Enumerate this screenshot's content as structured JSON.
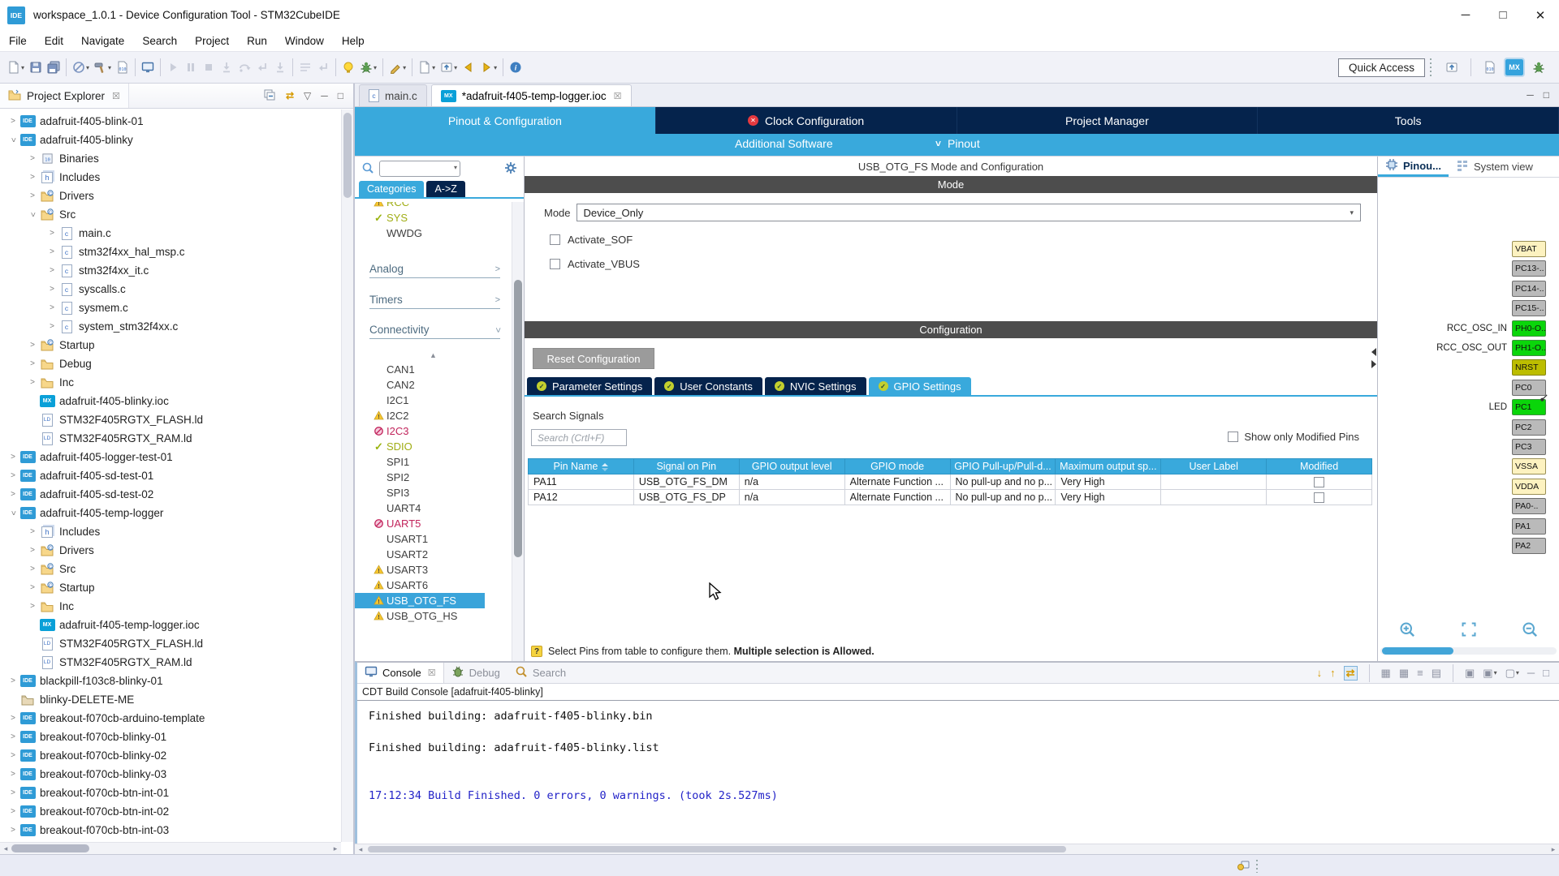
{
  "colors": {
    "accent": "#39a9dc",
    "navy": "#05234c",
    "section_gray": "#4d4d4d",
    "pin_green": "#0ad60a",
    "pin_gray": "#bababa",
    "pin_power": "#fdf2c0",
    "pin_nrst": "#bcbd00",
    "console_info_blue": "#2323c8"
  },
  "window": {
    "title": "workspace_1.0.1 - Device Configuration Tool - STM32CubeIDE",
    "controls": [
      "minimize",
      "maximize",
      "close"
    ]
  },
  "menu": {
    "items": [
      "File",
      "Edit",
      "Navigate",
      "Search",
      "Project",
      "Run",
      "Window",
      "Help"
    ]
  },
  "toolbar": {
    "icons": [
      {
        "kind": "doc",
        "name": "new-wizard-icon",
        "caret": true
      },
      {
        "kind": "floppy",
        "name": "save-icon"
      },
      {
        "kind": "floppy2",
        "name": "save-all-icon"
      },
      {
        "kind": "sep"
      },
      {
        "kind": "circleslash",
        "name": "skip-breakpoints-icon",
        "caret": true
      },
      {
        "kind": "hammer",
        "name": "build-icon",
        "caret": true
      },
      {
        "kind": "bindoc",
        "name": "binary-tools-icon"
      },
      {
        "kind": "sep"
      },
      {
        "kind": "monitor",
        "name": "device-configuration-icon"
      },
      {
        "kind": "sep"
      },
      {
        "kind": "play",
        "name": "resume-icon",
        "muted": true
      },
      {
        "kind": "pause",
        "name": "suspend-icon",
        "muted": true
      },
      {
        "kind": "stop",
        "name": "terminate-icon",
        "muted": true
      },
      {
        "kind": "stepi",
        "name": "disconnect-icon",
        "muted": true
      },
      {
        "kind": "stepo",
        "name": "step-into-icon",
        "muted": true
      },
      {
        "kind": "stepr",
        "name": "step-over-icon",
        "muted": true
      },
      {
        "kind": "stepi",
        "name": "step-return-icon",
        "muted": true
      },
      {
        "kind": "sep"
      },
      {
        "kind": "lines",
        "name": "instruction-stepping-icon",
        "muted": true
      },
      {
        "kind": "stepr",
        "name": "use-step-filters-icon",
        "muted": true
      },
      {
        "kind": "sep"
      },
      {
        "kind": "bulb",
        "name": "external-tools-icon"
      },
      {
        "kind": "spider",
        "name": "debug-icon",
        "caret": true
      },
      {
        "kind": "sep"
      },
      {
        "kind": "pen",
        "name": "run-icon",
        "caret": true
      },
      {
        "kind": "sep"
      },
      {
        "kind": "doc",
        "name": "profile-icon",
        "caret": true
      },
      {
        "kind": "upload",
        "name": "new-launch-config-icon",
        "caret": true
      },
      {
        "kind": "back",
        "name": "back-icon"
      },
      {
        "kind": "fwd",
        "name": "forward-icon",
        "caret": true
      },
      {
        "kind": "sep"
      },
      {
        "kind": "info",
        "name": "information-icon"
      }
    ],
    "quick_access_label": "Quick Access",
    "perspectives": [
      "open-perspective-icon",
      "cpp-perspective-icon",
      "mx-perspective-icon",
      "debug-perspective-icon"
    ]
  },
  "explorer": {
    "title": "Project Explorer",
    "tools": [
      "collapse-all-icon",
      "link-editor-icon",
      "view-menu-icon",
      "minimize-icon",
      "maximize-icon"
    ],
    "items": [
      {
        "label": "adafruit-f405-blink-01",
        "level": 0,
        "chevron": "collapsed",
        "icon": "project"
      },
      {
        "label": "adafruit-f405-blinky",
        "level": 0,
        "chevron": "expanded",
        "icon": "project"
      },
      {
        "label": "Binaries",
        "level": 1,
        "chevron": "collapsed",
        "icon": "binaries"
      },
      {
        "label": "Includes",
        "level": 1,
        "chevron": "collapsed",
        "icon": "includes"
      },
      {
        "label": "Drivers",
        "level": 1,
        "chevron": "collapsed",
        "icon": "folder-c"
      },
      {
        "label": "Src",
        "level": 1,
        "chevron": "expanded",
        "icon": "folder-c"
      },
      {
        "label": "main.c",
        "level": 2,
        "chevron": "collapsed",
        "icon": "c-file"
      },
      {
        "label": "stm32f4xx_hal_msp.c",
        "level": 2,
        "chevron": "collapsed",
        "icon": "c-file"
      },
      {
        "label": "stm32f4xx_it.c",
        "level": 2,
        "chevron": "collapsed",
        "icon": "c-file"
      },
      {
        "label": "syscalls.c",
        "level": 2,
        "chevron": "collapsed",
        "icon": "c-file"
      },
      {
        "label": "sysmem.c",
        "level": 2,
        "chevron": "collapsed",
        "icon": "c-file"
      },
      {
        "label": "system_stm32f4xx.c",
        "level": 2,
        "chevron": "collapsed",
        "icon": "c-file"
      },
      {
        "label": "Startup",
        "level": 1,
        "chevron": "collapsed",
        "icon": "folder-c"
      },
      {
        "label": "Debug",
        "level": 1,
        "chevron": "collapsed",
        "icon": "folder"
      },
      {
        "label": "Inc",
        "level": 1,
        "chevron": "collapsed",
        "icon": "folder"
      },
      {
        "label": "adafruit-f405-blinky.ioc",
        "level": 1,
        "chevron": "none",
        "icon": "mx"
      },
      {
        "label": "STM32F405RGTX_FLASH.ld",
        "level": 1,
        "chevron": "none",
        "icon": "ld"
      },
      {
        "label": "STM32F405RGTX_RAM.ld",
        "level": 1,
        "chevron": "none",
        "icon": "ld"
      },
      {
        "label": "adafruit-f405-logger-test-01",
        "level": 0,
        "chevron": "collapsed",
        "icon": "project"
      },
      {
        "label": "adafruit-f405-sd-test-01",
        "level": 0,
        "chevron": "collapsed",
        "icon": "project"
      },
      {
        "label": "adafruit-f405-sd-test-02",
        "level": 0,
        "chevron": "collapsed",
        "icon": "project"
      },
      {
        "label": "adafruit-f405-temp-logger",
        "level": 0,
        "chevron": "expanded",
        "icon": "project"
      },
      {
        "label": "Includes",
        "level": 1,
        "chevron": "collapsed",
        "icon": "includes"
      },
      {
        "label": "Drivers",
        "level": 1,
        "chevron": "collapsed",
        "icon": "folder-c"
      },
      {
        "label": "Src",
        "level": 1,
        "chevron": "collapsed",
        "icon": "folder-c"
      },
      {
        "label": "Startup",
        "level": 1,
        "chevron": "collapsed",
        "icon": "folder-c"
      },
      {
        "label": "Inc",
        "level": 1,
        "chevron": "collapsed",
        "icon": "folder"
      },
      {
        "label": "adafruit-f405-temp-logger.ioc",
        "level": 1,
        "chevron": "none",
        "icon": "mx"
      },
      {
        "label": "STM32F405RGTX_FLASH.ld",
        "level": 1,
        "chevron": "none",
        "icon": "ld"
      },
      {
        "label": "STM32F405RGTX_RAM.ld",
        "level": 1,
        "chevron": "none",
        "icon": "ld"
      },
      {
        "label": "blackpill-f103c8-blinky-01",
        "level": 0,
        "chevron": "collapsed",
        "icon": "project"
      },
      {
        "label": "blinky-DELETE-ME",
        "level": 0,
        "chevron": "none",
        "icon": "folder-plain"
      },
      {
        "label": "breakout-f070cb-arduino-template",
        "level": 0,
        "chevron": "collapsed",
        "icon": "project"
      },
      {
        "label": "breakout-f070cb-blinky-01",
        "level": 0,
        "chevron": "collapsed",
        "icon": "project"
      },
      {
        "label": "breakout-f070cb-blinky-02",
        "level": 0,
        "chevron": "collapsed",
        "icon": "project"
      },
      {
        "label": "breakout-f070cb-blinky-03",
        "level": 0,
        "chevron": "collapsed",
        "icon": "project"
      },
      {
        "label": "breakout-f070cb-btn-int-01",
        "level": 0,
        "chevron": "collapsed",
        "icon": "project"
      },
      {
        "label": "breakout-f070cb-btn-int-02",
        "level": 0,
        "chevron": "collapsed",
        "icon": "project"
      },
      {
        "label": "breakout-f070cb-btn-int-03",
        "level": 0,
        "chevron": "collapsed",
        "icon": "project"
      }
    ]
  },
  "editor": {
    "tabs": [
      {
        "label": "main.c",
        "icon": "c-file",
        "active": false,
        "closable": false
      },
      {
        "label": "*adafruit-f405-temp-logger.ioc",
        "icon": "mx",
        "active": true,
        "closable": true
      }
    ]
  },
  "ioc": {
    "config_tabs": [
      {
        "label": "Pinout & Configuration",
        "active": true,
        "error": false
      },
      {
        "label": "Clock Configuration",
        "active": false,
        "error": true
      },
      {
        "label": "Project Manager",
        "active": false,
        "error": false
      },
      {
        "label": "Tools",
        "active": false,
        "error": false
      }
    ],
    "software_bar": {
      "additional": "Additional Software",
      "pinout": "Pinout"
    },
    "categories": {
      "tabs": [
        {
          "label": "Categories",
          "active": true
        },
        {
          "label": "A->Z",
          "active": false
        }
      ],
      "top_items": [
        {
          "label": "RCC",
          "status": "warning",
          "partial": true,
          "olive": true
        },
        {
          "label": "SYS",
          "status": "ok",
          "olive": true
        },
        {
          "label": "WWDG",
          "status": "none",
          "olive": false
        }
      ],
      "sections": [
        {
          "label": "Analog",
          "state": "collapsed"
        },
        {
          "label": "Timers",
          "state": "collapsed"
        },
        {
          "label": "Connectivity",
          "state": "expanded"
        }
      ],
      "connectivity": [
        {
          "label": "CAN1",
          "status": "none"
        },
        {
          "label": "CAN2",
          "status": "none"
        },
        {
          "label": "I2C1",
          "status": "none"
        },
        {
          "label": "I2C2",
          "status": "warning"
        },
        {
          "label": "I2C3",
          "status": "blocked"
        },
        {
          "label": "SDIO",
          "status": "ok",
          "olive": true
        },
        {
          "label": "SPI1",
          "status": "none"
        },
        {
          "label": "SPI2",
          "status": "none"
        },
        {
          "label": "SPI3",
          "status": "none"
        },
        {
          "label": "UART4",
          "status": "none"
        },
        {
          "label": "UART5",
          "status": "blocked"
        },
        {
          "label": "USART1",
          "status": "none"
        },
        {
          "label": "USART2",
          "status": "none"
        },
        {
          "label": "USART3",
          "status": "warning"
        },
        {
          "label": "USART6",
          "status": "warning"
        },
        {
          "label": "USB_OTG_FS",
          "status": "warning",
          "selected": true
        },
        {
          "label": "USB_OTG_HS",
          "status": "warning"
        }
      ]
    },
    "mode": {
      "panel_title": "USB_OTG_FS Mode and Configuration",
      "section_label": "Mode",
      "mode_label": "Mode",
      "mode_value": "Device_Only",
      "checkboxes": [
        {
          "label": "Activate_SOF",
          "checked": false
        },
        {
          "label": "Activate_VBUS",
          "checked": false
        }
      ]
    },
    "configuration": {
      "section_label": "Configuration",
      "reset_button": "Reset Configuration",
      "tabs": [
        {
          "label": "Parameter Settings",
          "active": false
        },
        {
          "label": "User Constants",
          "active": false
        },
        {
          "label": "NVIC Settings",
          "active": false
        },
        {
          "label": "GPIO Settings",
          "active": true
        }
      ],
      "search_label": "Search Signals",
      "search_placeholder": "Search (Crtl+F)",
      "show_modified_label": "Show only Modified Pins",
      "show_modified_checked": false
    },
    "gpio_table": {
      "columns": [
        "Pin Name",
        "Signal on Pin",
        "GPIO output level",
        "GPIO mode",
        "GPIO Pull-up/Pull-d...",
        "Maximum output sp...",
        "User Label",
        "Modified"
      ],
      "sorted_column": "Pin Name",
      "rows": [
        {
          "pin": "PA11",
          "signal": "USB_OTG_FS_DM",
          "level": "n/a",
          "mode": "Alternate Function ...",
          "pull": "No pull-up and no p...",
          "speed": "Very High",
          "user_label": "",
          "modified": false
        },
        {
          "pin": "PA12",
          "signal": "USB_OTG_FS_DP",
          "level": "n/a",
          "mode": "Alternate Function ...",
          "pull": "No pull-up and no p...",
          "speed": "Very High",
          "user_label": "",
          "modified": false
        }
      ]
    },
    "help": {
      "text": "Select Pins from table to configure them. ",
      "bold": "Multiple selection is Allowed."
    },
    "pinout": {
      "tabs": [
        {
          "label": "Pinou...",
          "active": true,
          "icon": "chip-icon"
        },
        {
          "label": "System view",
          "active": false,
          "icon": "grid-icon"
        }
      ],
      "pins": [
        {
          "label": "VBAT",
          "color": "power"
        },
        {
          "label": "PC13-..",
          "color": "default"
        },
        {
          "label": "PC14-..",
          "color": "default"
        },
        {
          "label": "PC15-..",
          "color": "default"
        },
        {
          "label": "PH0-O..",
          "color": "active",
          "left_label": "RCC_OSC_IN"
        },
        {
          "label": "PH1-O..",
          "color": "active",
          "left_label": "RCC_OSC_OUT"
        },
        {
          "label": "NRST",
          "color": "nrst"
        },
        {
          "label": "PC0",
          "color": "default"
        },
        {
          "label": "PC1",
          "color": "active",
          "left_label": "LED",
          "pinned": true
        },
        {
          "label": "PC2",
          "color": "default"
        },
        {
          "label": "PC3",
          "color": "default"
        },
        {
          "label": "VSSA",
          "color": "power"
        },
        {
          "label": "VDDA",
          "color": "power"
        },
        {
          "label": "PA0-..",
          "color": "default"
        },
        {
          "label": "PA1",
          "color": "default"
        },
        {
          "label": "PA2",
          "color": "default"
        }
      ],
      "controls": [
        "zoom-in-icon",
        "fit-view-icon",
        "zoom-out-icon"
      ]
    }
  },
  "console": {
    "tabs": [
      {
        "label": "Console",
        "active": true,
        "icon": "console-icon",
        "closable": true
      },
      {
        "label": "Debug",
        "active": false,
        "icon": "bug-icon",
        "closable": false
      },
      {
        "label": "Search",
        "active": false,
        "icon": "search-icon",
        "closable": false
      }
    ],
    "toolbar_icons": [
      {
        "name": "scroll-to-bottom-icon",
        "glyph": "↓",
        "style": "gold"
      },
      {
        "name": "scroll-to-top-icon",
        "glyph": "↑",
        "style": "gold"
      },
      {
        "name": "word-wrap-icon",
        "glyph": "⇄",
        "style": "gold sel"
      },
      {
        "name": "sep"
      },
      {
        "name": "scroll-lock-icon",
        "glyph": "▦"
      },
      {
        "name": "lock-console-icon",
        "glyph": "▦"
      },
      {
        "name": "wrap-lines-icon",
        "glyph": "≡"
      },
      {
        "name": "clear-console-icon",
        "glyph": "▤"
      },
      {
        "name": "sep"
      },
      {
        "name": "pin-console-icon",
        "glyph": "▣"
      },
      {
        "name": "display-selected-console-icon",
        "glyph": "▣",
        "caret": true
      },
      {
        "name": "open-console-icon",
        "glyph": "▢",
        "caret": true
      },
      {
        "name": "minimize-icon",
        "glyph": "─"
      },
      {
        "name": "maximize-icon",
        "glyph": "□"
      }
    ],
    "header": "CDT Build Console [adafruit-f405-blinky]",
    "lines": [
      {
        "text": "Finished building: adafruit-f405-blinky.bin",
        "blue": false
      },
      {
        "text": "",
        "blue": false
      },
      {
        "text": "Finished building: adafruit-f405-blinky.list",
        "blue": false
      },
      {
        "text": "",
        "blue": false
      },
      {
        "text": "",
        "blue": false
      },
      {
        "text": "17:12:34 Build Finished. 0 errors, 0 warnings. (took 2s.527ms)",
        "blue": true
      }
    ]
  },
  "statusbar": {
    "items": [
      "launch-progress-icon"
    ]
  }
}
